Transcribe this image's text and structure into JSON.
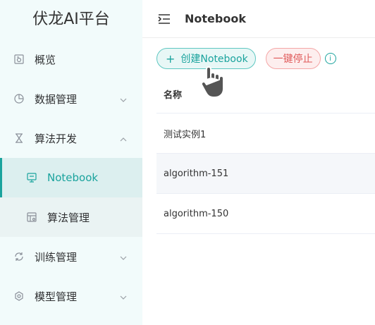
{
  "sidebar": {
    "logo": "伏龙AI平台",
    "items": [
      {
        "label": "概览",
        "icon": "overview-icon"
      },
      {
        "label": "数据管理",
        "icon": "data-icon"
      },
      {
        "label": "算法开发",
        "icon": "algorithm-icon"
      },
      {
        "label": "Notebook",
        "icon": "notebook-icon"
      },
      {
        "label": "算法管理",
        "icon": "algorithm-manage-icon"
      },
      {
        "label": "训练管理",
        "icon": "training-icon"
      },
      {
        "label": "模型管理",
        "icon": "model-icon"
      }
    ]
  },
  "header": {
    "title": "Notebook"
  },
  "toolbar": {
    "create_label": "创建Notebook",
    "stop_label": "一键停止"
  },
  "table": {
    "column_name": "名称",
    "rows": [
      "测试实例1",
      "algorithm-151",
      "algorithm-150"
    ]
  },
  "colors": {
    "accent": "#1aa39d",
    "danger": "#e05a5a",
    "sidebar_bg": "#f2fbfb"
  }
}
